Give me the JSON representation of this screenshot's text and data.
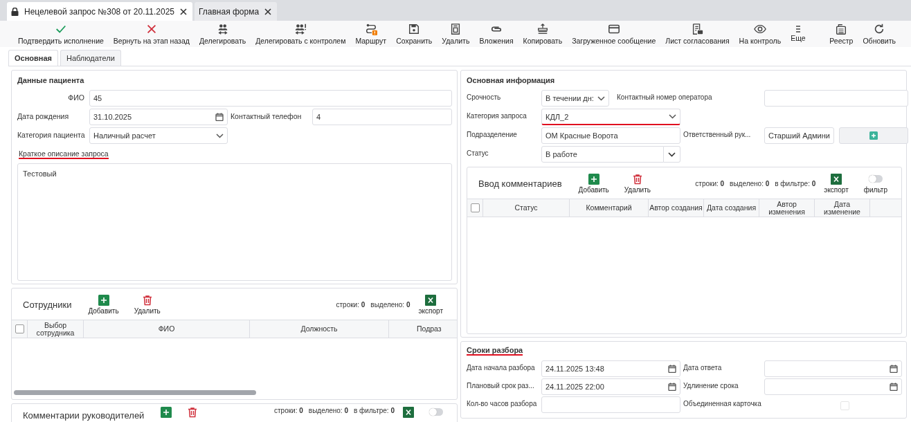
{
  "tabs": [
    {
      "label": "Нецелевой запрос №308 от 20.11.2025",
      "selected": true,
      "locked": true
    },
    {
      "label": "Главная форма",
      "selected": false,
      "locked": false
    }
  ],
  "toolbar": [
    {
      "label": "Подтвердить исполнение"
    },
    {
      "label": "Вернуть на этап назад"
    },
    {
      "label": "Делегировать"
    },
    {
      "label": "Делегировать с контролем"
    },
    {
      "label": "Маршрут"
    },
    {
      "label": "Сохранить"
    },
    {
      "label": "Удалить"
    },
    {
      "label": "Вложения"
    },
    {
      "label": "Копировать"
    },
    {
      "label": "Загруженное сообщение"
    },
    {
      "label": "Лист согласования"
    },
    {
      "label": "На контроль"
    },
    {
      "label": "Еще"
    }
  ],
  "toolbar_right": [
    {
      "label": "Реестр"
    },
    {
      "label": "Обновить"
    }
  ],
  "form_tabs": [
    {
      "label": "Основная",
      "selected": true
    },
    {
      "label": "Наблюдатели",
      "selected": false
    }
  ],
  "patient": {
    "title": "Данные пациента",
    "fields": [
      {
        "label": "ФИО",
        "value": "45",
        "kind": "text"
      },
      {
        "label": "Дата рождения",
        "value": "31.10.2025",
        "kind": "date"
      },
      {
        "label": "Контактный телефон",
        "value": "4",
        "kind": "text"
      },
      {
        "label": "Категория пациента",
        "value": "Наличный расчет",
        "kind": "select"
      }
    ],
    "description": {
      "label": "Краткое описание запроса",
      "value": "Тестовый",
      "underlined": true
    }
  },
  "employees": {
    "title": "Сотрудники",
    "buttons": [
      {
        "kind": "add",
        "label": "Добавить"
      },
      {
        "kind": "delete",
        "label": "Удалить"
      }
    ],
    "stats": [
      {
        "label": "строки:",
        "value": "0"
      },
      {
        "label": "выделено:",
        "value": "0"
      }
    ],
    "tools": [
      {
        "kind": "export",
        "label": "экспорт"
      }
    ],
    "select_all": {
      "checked": false
    },
    "columns": [
      "Выбор сотрудника",
      "ФИО",
      "Должность",
      "Подраз"
    ]
  },
  "leader_comments": {
    "title": "Комментарии руководителей",
    "buttons": [
      {
        "kind": "add"
      },
      {
        "kind": "delete"
      }
    ],
    "stats": [
      {
        "label": "строки:",
        "value": "0"
      },
      {
        "label": "выделено:",
        "value": "0"
      },
      {
        "label": "в фильтре:",
        "value": "0"
      }
    ],
    "tools": [
      {
        "kind": "export"
      },
      {
        "kind": "filter",
        "on": false
      }
    ]
  },
  "info": {
    "title": "Основная информация",
    "fields": [
      {
        "label": "Срочность",
        "value": "В течении дн:",
        "kind": "select"
      },
      {
        "label": "Контактный номер оператора",
        "kind": "text"
      },
      {
        "label": "Категория запроса",
        "value": "КДЛ_2",
        "kind": "select",
        "underlined": true
      },
      {
        "label": "Подразделение",
        "value": "ОМ Красные Ворота",
        "kind": "text"
      },
      {
        "label": "Ответственный рук...",
        "value": "Старший Админи",
        "kind": "text"
      },
      {
        "label": "Статус",
        "value": "В работе",
        "kind": "split"
      }
    ],
    "comments": {
      "title": "Ввод комментариев",
      "buttons": [
        {
          "kind": "add",
          "label": "Добавить"
        },
        {
          "kind": "delete",
          "label": "Удалить"
        }
      ],
      "stats": [
        {
          "label": "строки:",
          "value": "0"
        },
        {
          "label": "выделено:",
          "value": "0"
        },
        {
          "label": "в фильтре:",
          "value": "0"
        }
      ],
      "tools": [
        {
          "kind": "export",
          "label": "экспорт"
        },
        {
          "kind": "filter",
          "label": "фильтр",
          "on": false
        }
      ],
      "select_all": {
        "checked": false
      },
      "columns": [
        "Статус",
        "Комментарий",
        "Автор создания",
        "Дата создания",
        "Автор изменения",
        "Дата изменение"
      ]
    }
  },
  "deadlines": {
    "title": "Сроки разбора",
    "underlined": true,
    "fields": [
      {
        "label": "Дата начала разбора",
        "value": "24.11.2025 13:48",
        "kind": "date"
      },
      {
        "label": "Дата ответа",
        "kind": "date"
      },
      {
        "label": "Плановый срок раз...",
        "value": "24.11.2025 22:00",
        "kind": "date"
      },
      {
        "label": "Удлинение срока",
        "kind": "date"
      },
      {
        "label": "Кол-во часов разбора",
        "kind": "text"
      },
      {
        "label": "Объединенная карточка",
        "kind": "checkbox",
        "checked": false,
        "disabled": true
      }
    ]
  }
}
